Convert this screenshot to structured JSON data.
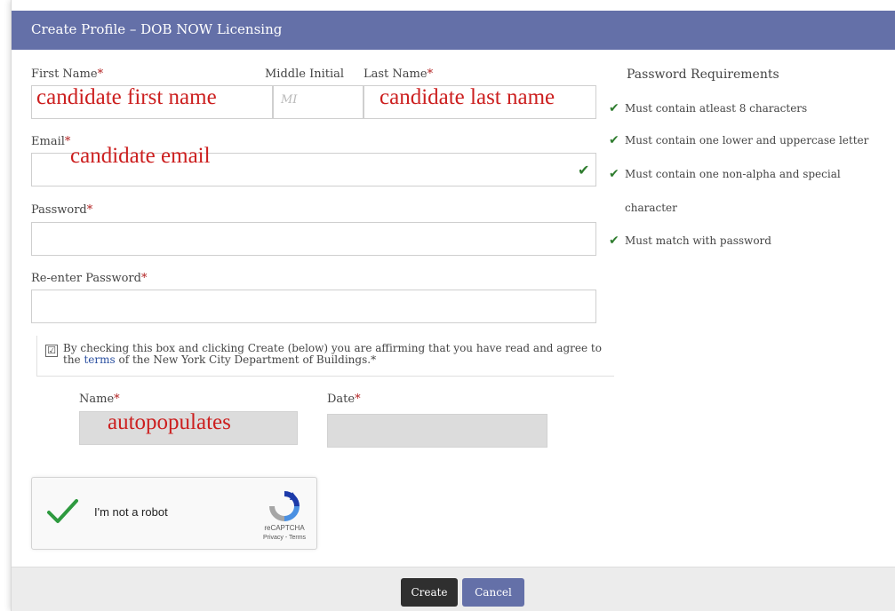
{
  "window": {
    "title": "Create Profile – DOB NOW Licensing"
  },
  "form": {
    "first_name": {
      "label": "First Name",
      "overlay": "candidate first name"
    },
    "middle_initial": {
      "label": "Middle Initial",
      "placeholder": "MI"
    },
    "last_name": {
      "label": "Last Name",
      "overlay": "candidate last name"
    },
    "email": {
      "label": "Email",
      "overlay": "candidate email"
    },
    "password": {
      "label": "Password"
    },
    "reenter_password": {
      "label": "Re-enter Password"
    },
    "required_marker": "*"
  },
  "password_requirements": {
    "title": "Password Requirements",
    "items": [
      "Must contain atleast 8 characters",
      "Must contain one lower and uppercase letter",
      "Must contain one non-alpha and special",
      "character",
      "Must match with password"
    ]
  },
  "agreement": {
    "text_before": "By checking this box and clicking Create (below) you are affirming that you have read and agree to the ",
    "link": "terms",
    "text_after": " of the New York City Department of Buildings.",
    "required_marker": "*",
    "checked_glyph": "☑"
  },
  "signature": {
    "name_label": "Name",
    "name_overlay": "autopopulates",
    "date_label": "Date"
  },
  "captcha": {
    "label": "I'm not a robot",
    "brand": "reCAPTCHA",
    "terms": "Privacy - Terms"
  },
  "buttons": {
    "create": "Create",
    "cancel": "Cancel"
  },
  "icons": {
    "valid_check": "checkmark-icon",
    "captcha_logo": "recaptcha-icon"
  },
  "colors": {
    "header": "#6470a8",
    "required": "#b22222",
    "check": "#2f7d2f",
    "annotation": "#cc1f1f"
  }
}
